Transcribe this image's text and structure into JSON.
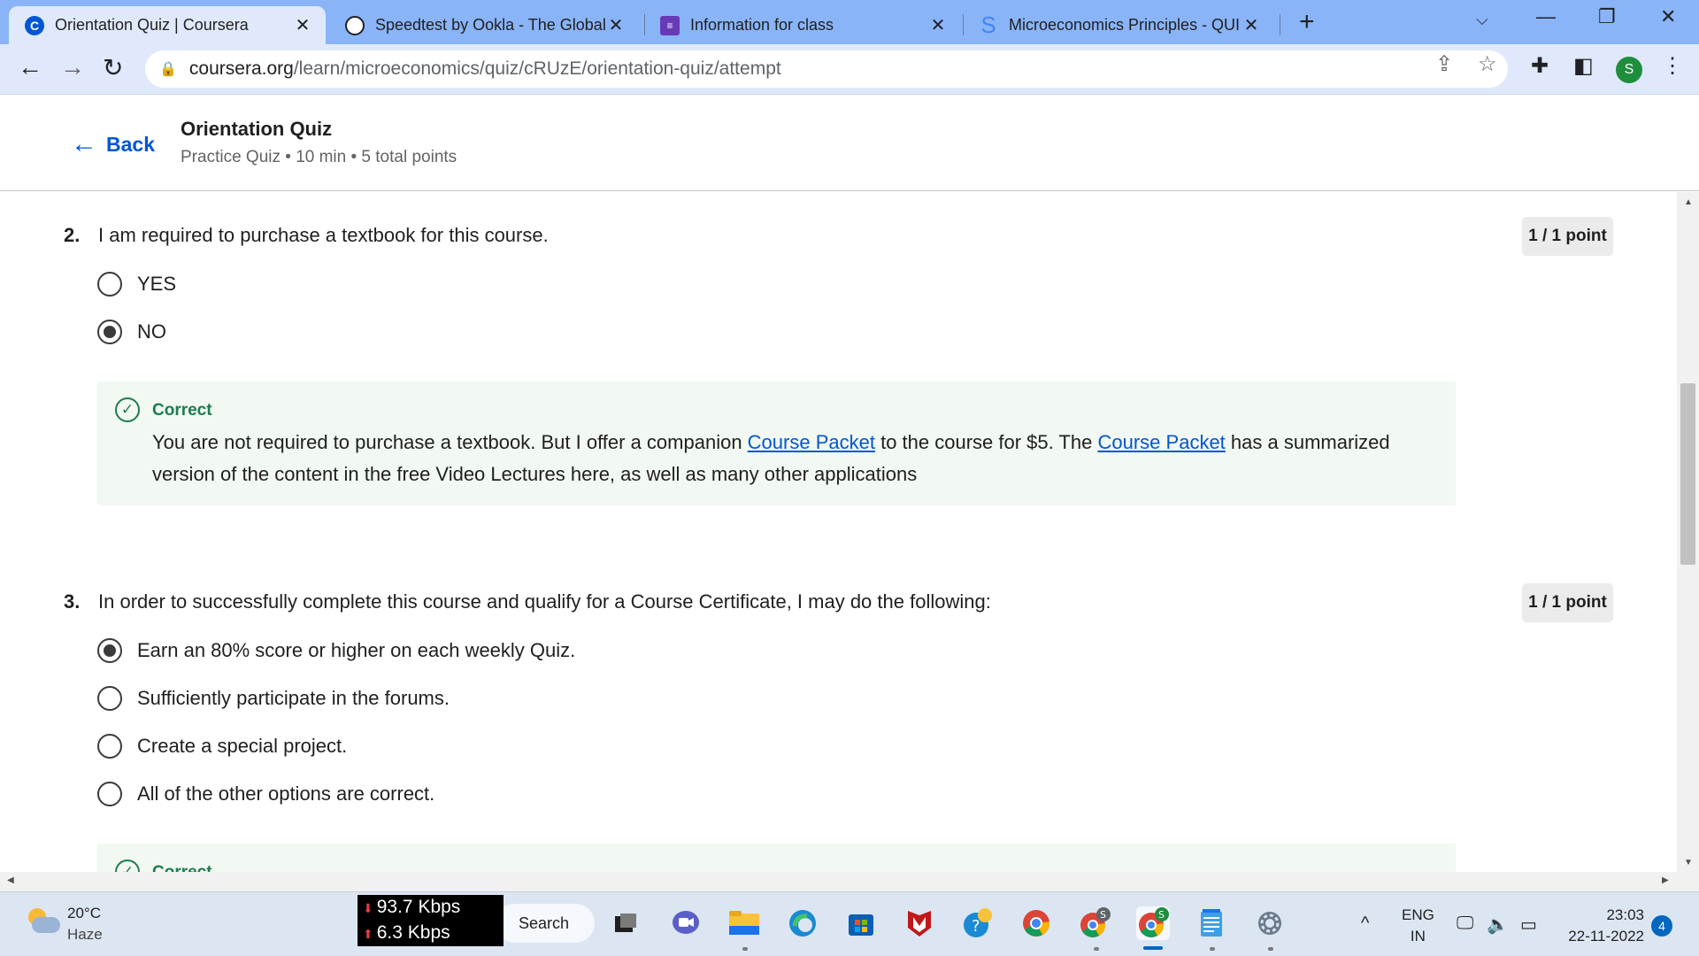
{
  "browser": {
    "tabs": [
      {
        "title": "Orientation Quiz | Coursera",
        "active": true
      },
      {
        "title": "Speedtest by Ookla - The Global",
        "active": false
      },
      {
        "title": "Information for class",
        "active": false
      },
      {
        "title": "Microeconomics Principles - QUI",
        "active": false
      }
    ],
    "url_host": "coursera.org",
    "url_path": "/learn/microeconomics/quiz/cRUzE/orientation-quiz/attempt",
    "profile_initial": "S"
  },
  "header": {
    "back_label": "Back",
    "title": "Orientation Quiz",
    "meta": "Practice Quiz • 10 min • 5 total points"
  },
  "questions": [
    {
      "number": "2.",
      "text": "I am required to purchase a textbook for this course.",
      "points": "1 / 1 point",
      "options": [
        {
          "label": "YES",
          "selected": false
        },
        {
          "label": "NO",
          "selected": true
        }
      ],
      "feedback": {
        "label": "Correct",
        "text_part1": "You are not required to purchase a textbook. But I offer a companion ",
        "link1": "Course Packet",
        "text_part2": " to the course for $5. The ",
        "link2": "Course Packet",
        "text_part3": " has a summarized version of the content in the free Video Lectures here, as well as many other applications"
      }
    },
    {
      "number": "3.",
      "text": "In order to successfully complete this course and qualify for a Course Certificate, I may do the following:",
      "points": "1 / 1 point",
      "options": [
        {
          "label": "Earn an 80% score or higher on each weekly Quiz.",
          "selected": true
        },
        {
          "label": "Sufficiently participate in the forums.",
          "selected": false
        },
        {
          "label": "Create a special project.",
          "selected": false
        },
        {
          "label": "All of the other options are correct.",
          "selected": false
        }
      ],
      "feedback": {
        "label": "Correct"
      }
    }
  ],
  "taskbar": {
    "weather_temp": "20°C",
    "weather_desc": "Haze",
    "net_down": "93.7 Kbps",
    "net_up": "6.3 Kbps",
    "search_label": "Search",
    "lang_line1": "ENG",
    "lang_line2": "IN",
    "time": "23:03",
    "date": "22-11-2022",
    "notification_count": "4"
  },
  "colors": {
    "tab_strip": "#8ab4f8",
    "coursera_blue": "#0056d2",
    "correct_green": "#1d7c50",
    "feedback_bg": "#f2f8f2"
  }
}
